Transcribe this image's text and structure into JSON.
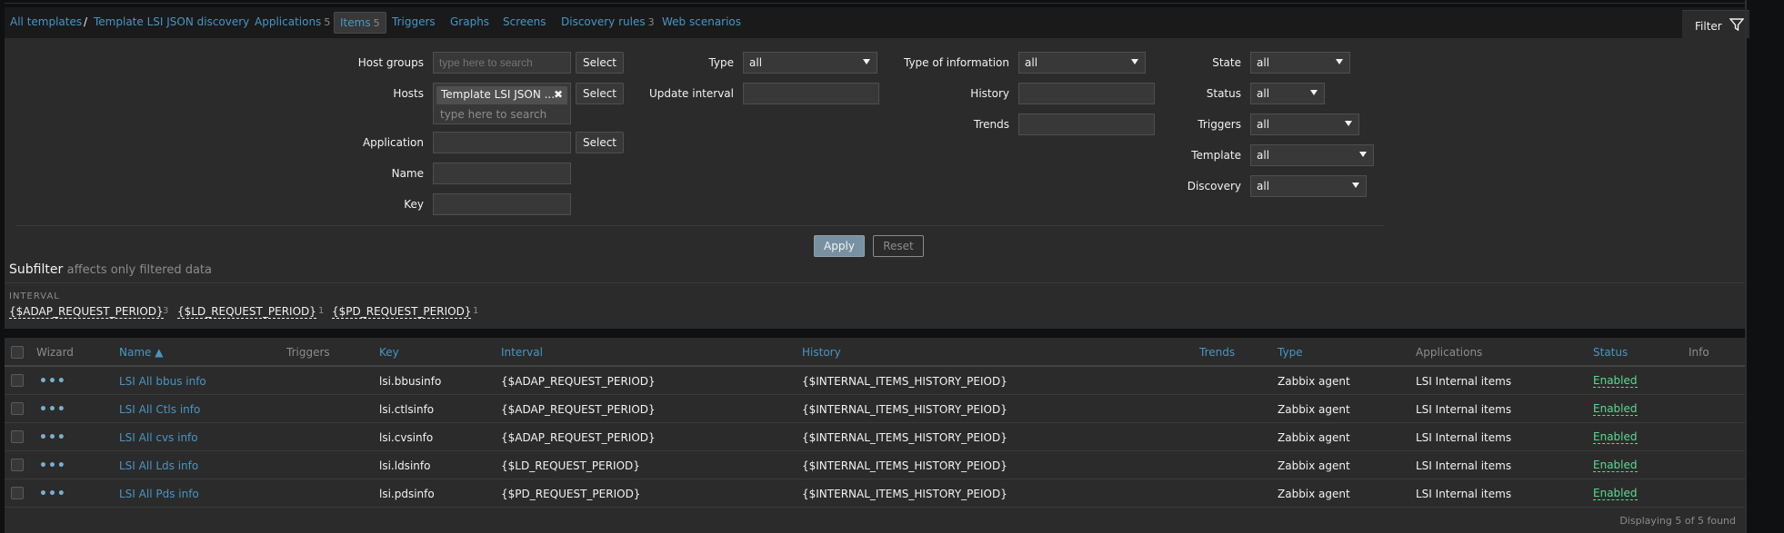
{
  "nav": {
    "breadcrumb_root": "All templates",
    "breadcrumb_sep": "/",
    "breadcrumb_template": "Template LSI JSON discovery",
    "tabs": [
      {
        "label": "Applications",
        "count": "5"
      },
      {
        "label": "Items",
        "count": "5"
      },
      {
        "label": "Triggers",
        "count": ""
      },
      {
        "label": "Graphs",
        "count": ""
      },
      {
        "label": "Screens",
        "count": ""
      },
      {
        "label": "Discovery rules",
        "count": "3"
      },
      {
        "label": "Web scenarios",
        "count": ""
      }
    ],
    "filter_label": "Filter"
  },
  "filter": {
    "host_groups_label": "Host groups",
    "host_groups_placeholder": "type here to search",
    "hosts_label": "Hosts",
    "hosts_tag": "Template LSI JSON ...",
    "hosts_placeholder": "type here to search",
    "application_label": "Application",
    "name_label": "Name",
    "key_label": "Key",
    "select_label": "Select",
    "type_label": "Type",
    "type_value": "all",
    "update_interval_label": "Update interval",
    "type_of_information_label": "Type of information",
    "type_of_information_value": "all",
    "history_label": "History",
    "trends_label": "Trends",
    "state_label": "State",
    "state_value": "all",
    "status_label": "Status",
    "status_value": "all",
    "triggers_label": "Triggers",
    "triggers_value": "all",
    "template_label": "Template",
    "template_value": "all",
    "discovery_label": "Discovery",
    "discovery_value": "all",
    "apply_label": "Apply",
    "reset_label": "Reset"
  },
  "subfilter": {
    "title": "Subfilter",
    "hint": "affects only filtered data",
    "group_label": "INTERVAL",
    "values": [
      {
        "label": "{$ADAP_REQUEST_PERIOD}",
        "count": "3"
      },
      {
        "label": "{$LD_REQUEST_PERIOD}",
        "count": "1"
      },
      {
        "label": "{$PD_REQUEST_PERIOD}",
        "count": "1"
      }
    ]
  },
  "table": {
    "headers": {
      "wizard": "Wizard",
      "name": "Name ▲",
      "triggers": "Triggers",
      "key": "Key",
      "interval": "Interval",
      "history": "History",
      "trends": "Trends",
      "type": "Type",
      "applications": "Applications",
      "status": "Status",
      "info": "Info"
    },
    "rows": [
      {
        "name": "LSI All bbus info",
        "key": "lsi.bbusinfo",
        "interval": "{$ADAP_REQUEST_PERIOD}",
        "history": "{$INTERNAL_ITEMS_HISTORY_PEIOD}",
        "type": "Zabbix agent",
        "applications": "LSI Internal items",
        "status": "Enabled"
      },
      {
        "name": "LSI All Ctls info",
        "key": "lsi.ctlsinfo",
        "interval": "{$ADAP_REQUEST_PERIOD}",
        "history": "{$INTERNAL_ITEMS_HISTORY_PEIOD}",
        "type": "Zabbix agent",
        "applications": "LSI Internal items",
        "status": "Enabled"
      },
      {
        "name": "LSI All cvs info",
        "key": "lsi.cvsinfo",
        "interval": "{$ADAP_REQUEST_PERIOD}",
        "history": "{$INTERNAL_ITEMS_HISTORY_PEIOD}",
        "type": "Zabbix agent",
        "applications": "LSI Internal items",
        "status": "Enabled"
      },
      {
        "name": "LSI All Lds info",
        "key": "lsi.ldsinfo",
        "interval": "{$LD_REQUEST_PERIOD}",
        "history": "{$INTERNAL_ITEMS_HISTORY_PEIOD}",
        "type": "Zabbix agent",
        "applications": "LSI Internal items",
        "status": "Enabled"
      },
      {
        "name": "LSI All Pds info",
        "key": "lsi.pdsinfo",
        "interval": "{$PD_REQUEST_PERIOD}",
        "history": "{$INTERNAL_ITEMS_HISTORY_PEIOD}",
        "type": "Zabbix agent",
        "applications": "LSI Internal items",
        "status": "Enabled"
      }
    ],
    "wizard_icon": "more-dots-icon",
    "footer": "Displaying 5 of 5 found"
  },
  "colors": {
    "link": "#4796c4",
    "enabled": "#59db8f",
    "panel": "#2b2b2b",
    "background": "#0e1012"
  }
}
